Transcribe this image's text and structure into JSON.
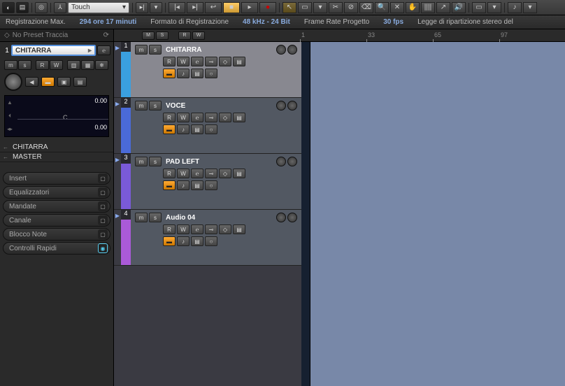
{
  "toolbar": {
    "automation_mode": "Touch"
  },
  "info_bar": {
    "max_rec_label": "Registrazione Max.",
    "max_rec_value": "294 ore 17 minuti",
    "format_label": "Formato di Registrazione",
    "format_value": "48 kHz - 24 Bit",
    "frame_rate_label": "Frame Rate Progetto",
    "frame_rate_value": "30 fps",
    "pan_law_label": "Legge di ripartizione stereo del"
  },
  "inspector": {
    "preset_text": "No Preset Traccia",
    "track_number": "1",
    "track_name": "CHITARRA",
    "volume_value": "0.00",
    "pan_label": "C",
    "pan_value": "0.00",
    "routing": [
      "CHITARRA",
      "MASTER"
    ],
    "sections": [
      {
        "label": "Insert",
        "active": false
      },
      {
        "label": "Equalizzatori",
        "active": false
      },
      {
        "label": "Mandate",
        "active": false
      },
      {
        "label": "Canale",
        "active": false
      },
      {
        "label": "Blocco Note",
        "active": false
      },
      {
        "label": "Controlli Rapidi",
        "active": true
      }
    ]
  },
  "ruler": {
    "marks": [
      {
        "pos": 0,
        "label": "1"
      },
      {
        "pos": 95,
        "label": "33"
      },
      {
        "pos": 190,
        "label": "65"
      },
      {
        "pos": 285,
        "label": "97"
      }
    ]
  },
  "tracks": [
    {
      "num": "1",
      "name": "CHITARRA",
      "color": "#3aa0e0",
      "selected": true
    },
    {
      "num": "2",
      "name": "VOCE",
      "color": "#4a6ad8",
      "selected": false
    },
    {
      "num": "3",
      "name": "PAD LEFT",
      "color": "#7a5ad8",
      "selected": false
    },
    {
      "num": "4",
      "name": "Audio 04",
      "color": "#aa5ad8",
      "selected": false
    }
  ]
}
